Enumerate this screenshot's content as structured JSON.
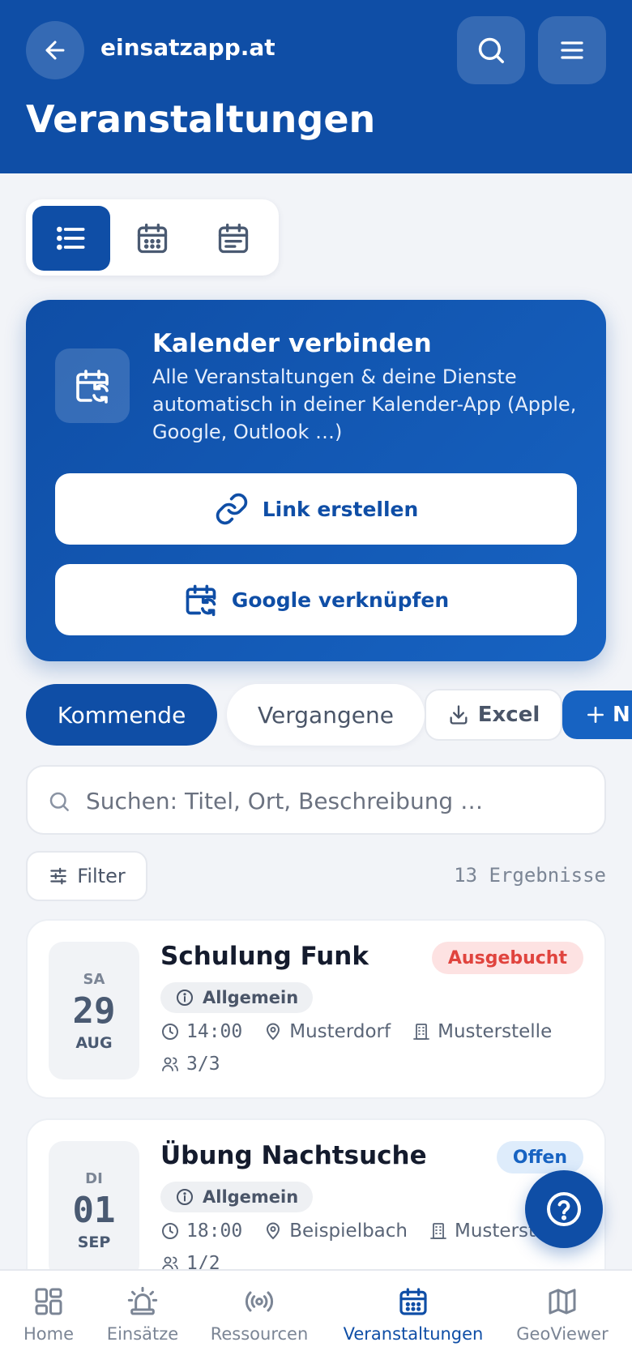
{
  "header": {
    "site_name": "einsatzapp.at",
    "page_title": "Veranstaltungen"
  },
  "calendar_connect": {
    "title": "Kalender verbinden",
    "description": "Alle Veranstaltungen & deine Dienste automatisch in deiner Kalender-App (Apple, Google, Outlook …)",
    "link_button": "Link erstellen",
    "google_button": "Google verknüpfen"
  },
  "tabs": {
    "upcoming": "Kommende",
    "past": "Vergangene",
    "excel": "Excel",
    "new": "N"
  },
  "search": {
    "placeholder": "Suchen: Titel, Ort, Beschreibung …"
  },
  "filter": {
    "label": "Filter",
    "result_count": "13 Ergebnisse"
  },
  "events": [
    {
      "dow": "SA",
      "day": "29",
      "month": "AUG",
      "title": "Schulung Funk",
      "badge": "Ausgebucht",
      "category": "Allgemein",
      "time": "14:00",
      "place": "Musterdorf",
      "unit": "Musterstelle",
      "participants": "3/3"
    },
    {
      "dow": "DI",
      "day": "01",
      "month": "SEP",
      "title": "Übung Nachtsuche",
      "badge": "Offen",
      "category": "Allgemein",
      "time": "18:00",
      "place": "Beispielbach",
      "unit": "Musterstelle",
      "participants": "1/2"
    }
  ],
  "bottom_nav": {
    "home": "Home",
    "einsaetze": "Einsätze",
    "ressourcen": "Ressourcen",
    "veranstaltungen": "Veranstaltungen",
    "geoviewer": "GeoViewer"
  },
  "colors": {
    "primary": "#0f4ea6",
    "accent": "#1763c2",
    "badge_red": "#e0443e",
    "background": "#f2f4f8"
  }
}
